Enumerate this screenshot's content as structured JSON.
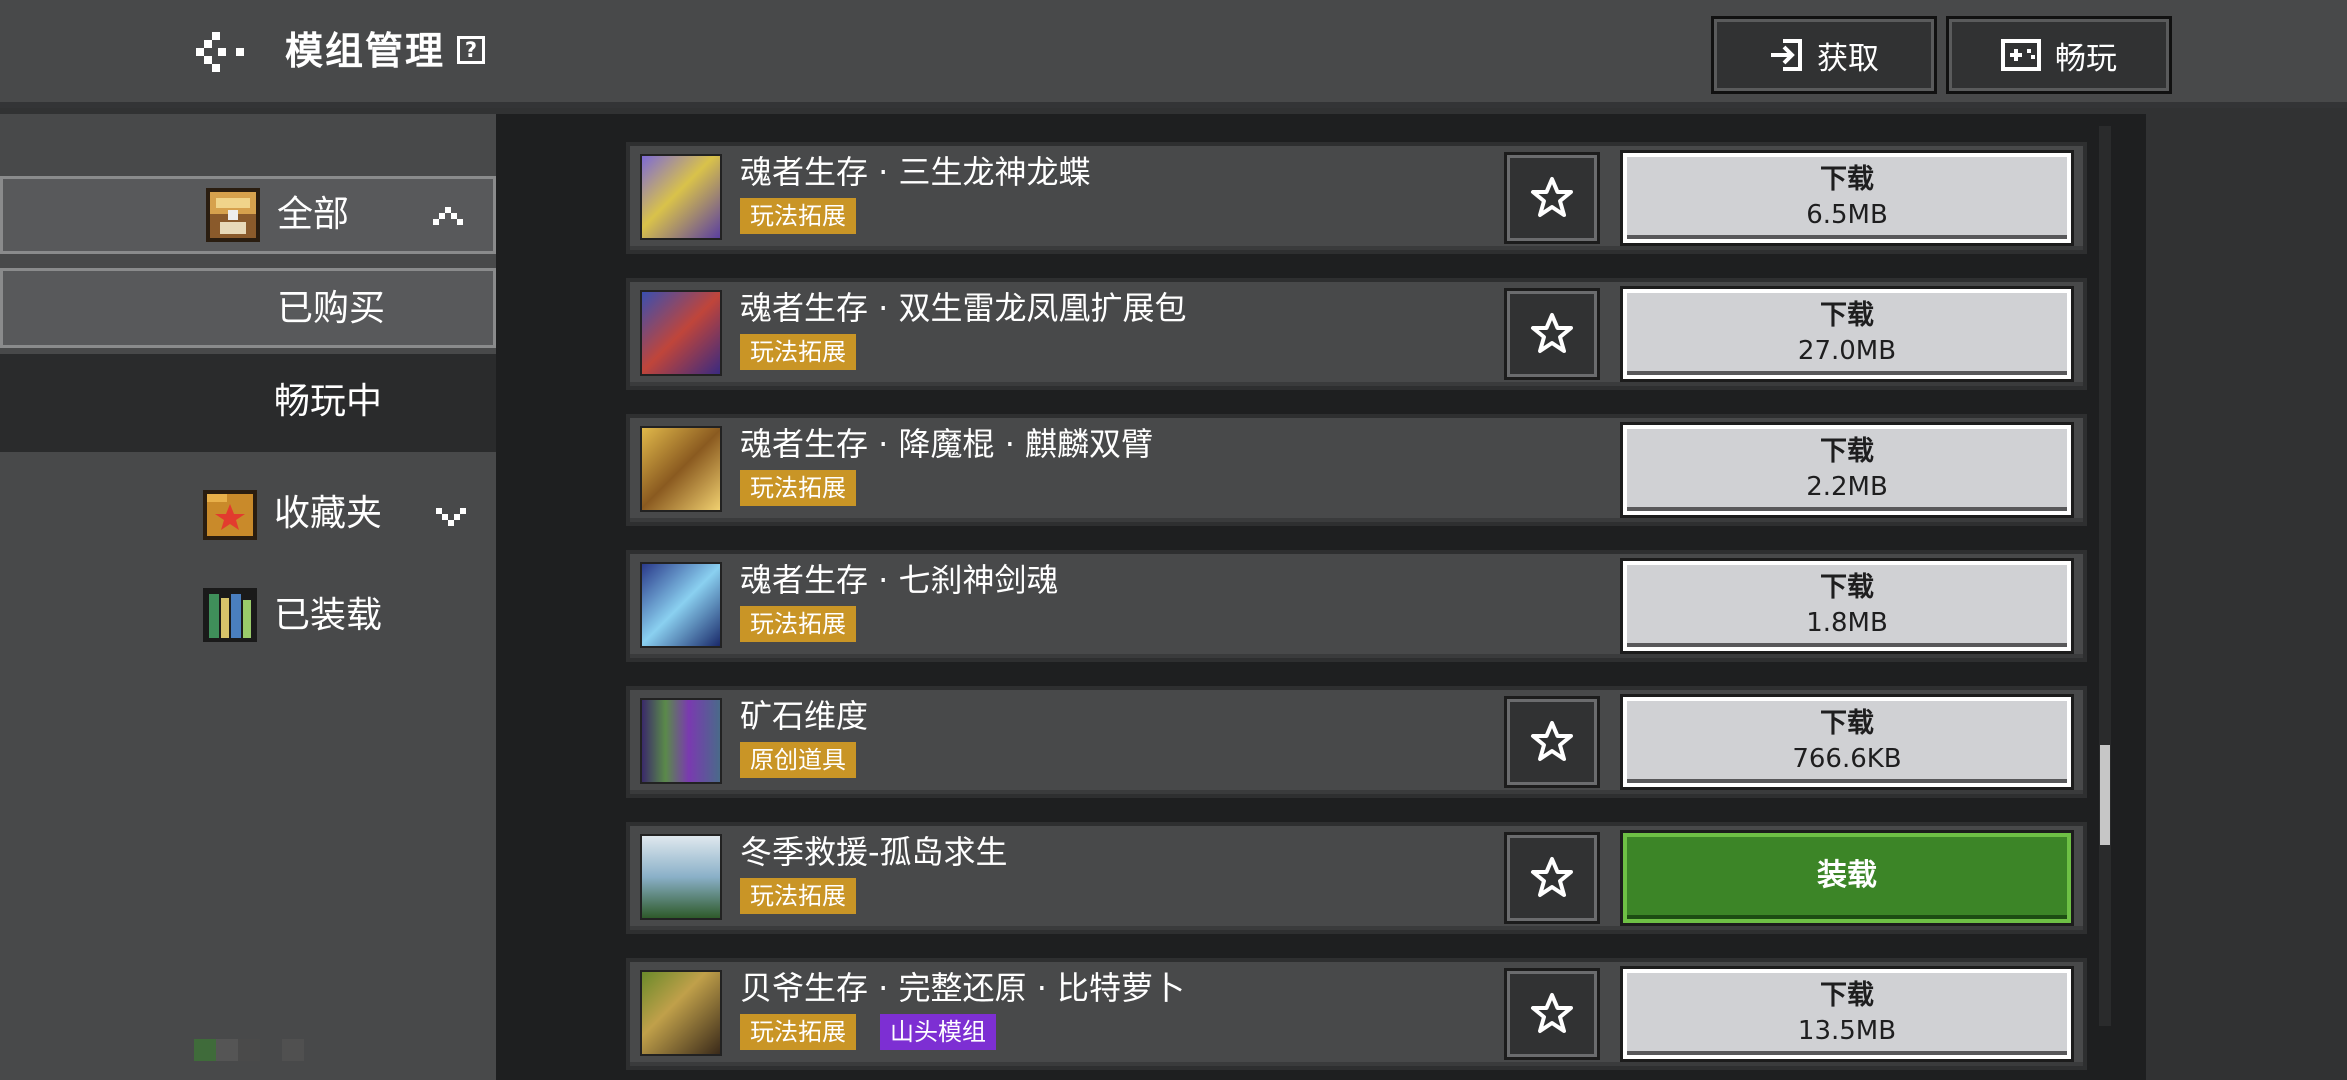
{
  "header": {
    "title": "模组管理",
    "help_label": "?",
    "get_button_label": "获取",
    "play_button_label": "畅玩"
  },
  "sidebar": {
    "items": [
      {
        "label": "全部",
        "icon": "chest-icon",
        "chevron": "up"
      },
      {
        "label": "已购买"
      },
      {
        "label": "畅玩中"
      },
      {
        "label": "收藏夹",
        "icon": "star-folder-icon",
        "chevron": "down"
      },
      {
        "label": "已装载",
        "icon": "bookshelf-icon"
      }
    ]
  },
  "mods": [
    {
      "title": "魂者生存 · 三生龙神龙蝶",
      "tags": [
        "玩法拓展"
      ],
      "favorite": true,
      "action": "下载",
      "size": "6.5MB"
    },
    {
      "title": "魂者生存 · 双生雷龙凤凰扩展包",
      "tags": [
        "玩法拓展"
      ],
      "favorite": true,
      "action": "下载",
      "size": "27.0MB"
    },
    {
      "title": "魂者生存 · 降魔棍 · 麒麟双臂",
      "tags": [
        "玩法拓展"
      ],
      "favorite": false,
      "action": "下载",
      "size": "2.2MB"
    },
    {
      "title": "魂者生存 · 七刹神剑魂",
      "tags": [
        "玩法拓展"
      ],
      "favorite": false,
      "action": "下载",
      "size": "1.8MB"
    },
    {
      "title": "矿石维度",
      "tags": [
        "原创道具"
      ],
      "favorite": true,
      "action": "下载",
      "size": "766.6KB"
    },
    {
      "title": "冬季救援-孤岛求生",
      "tags": [
        "玩法拓展"
      ],
      "favorite": true,
      "action": "装载",
      "size": ""
    },
    {
      "title": "贝爷生存 · 完整还原 · 比特萝卜",
      "tags": [
        "玩法拓展",
        "山头模组"
      ],
      "favorite": true,
      "action": "下载",
      "size": "13.5MB"
    }
  ],
  "colors": {
    "tag_gold": "#c99526",
    "tag_purple": "#7d2fd3",
    "load_green": "#3c8527"
  }
}
